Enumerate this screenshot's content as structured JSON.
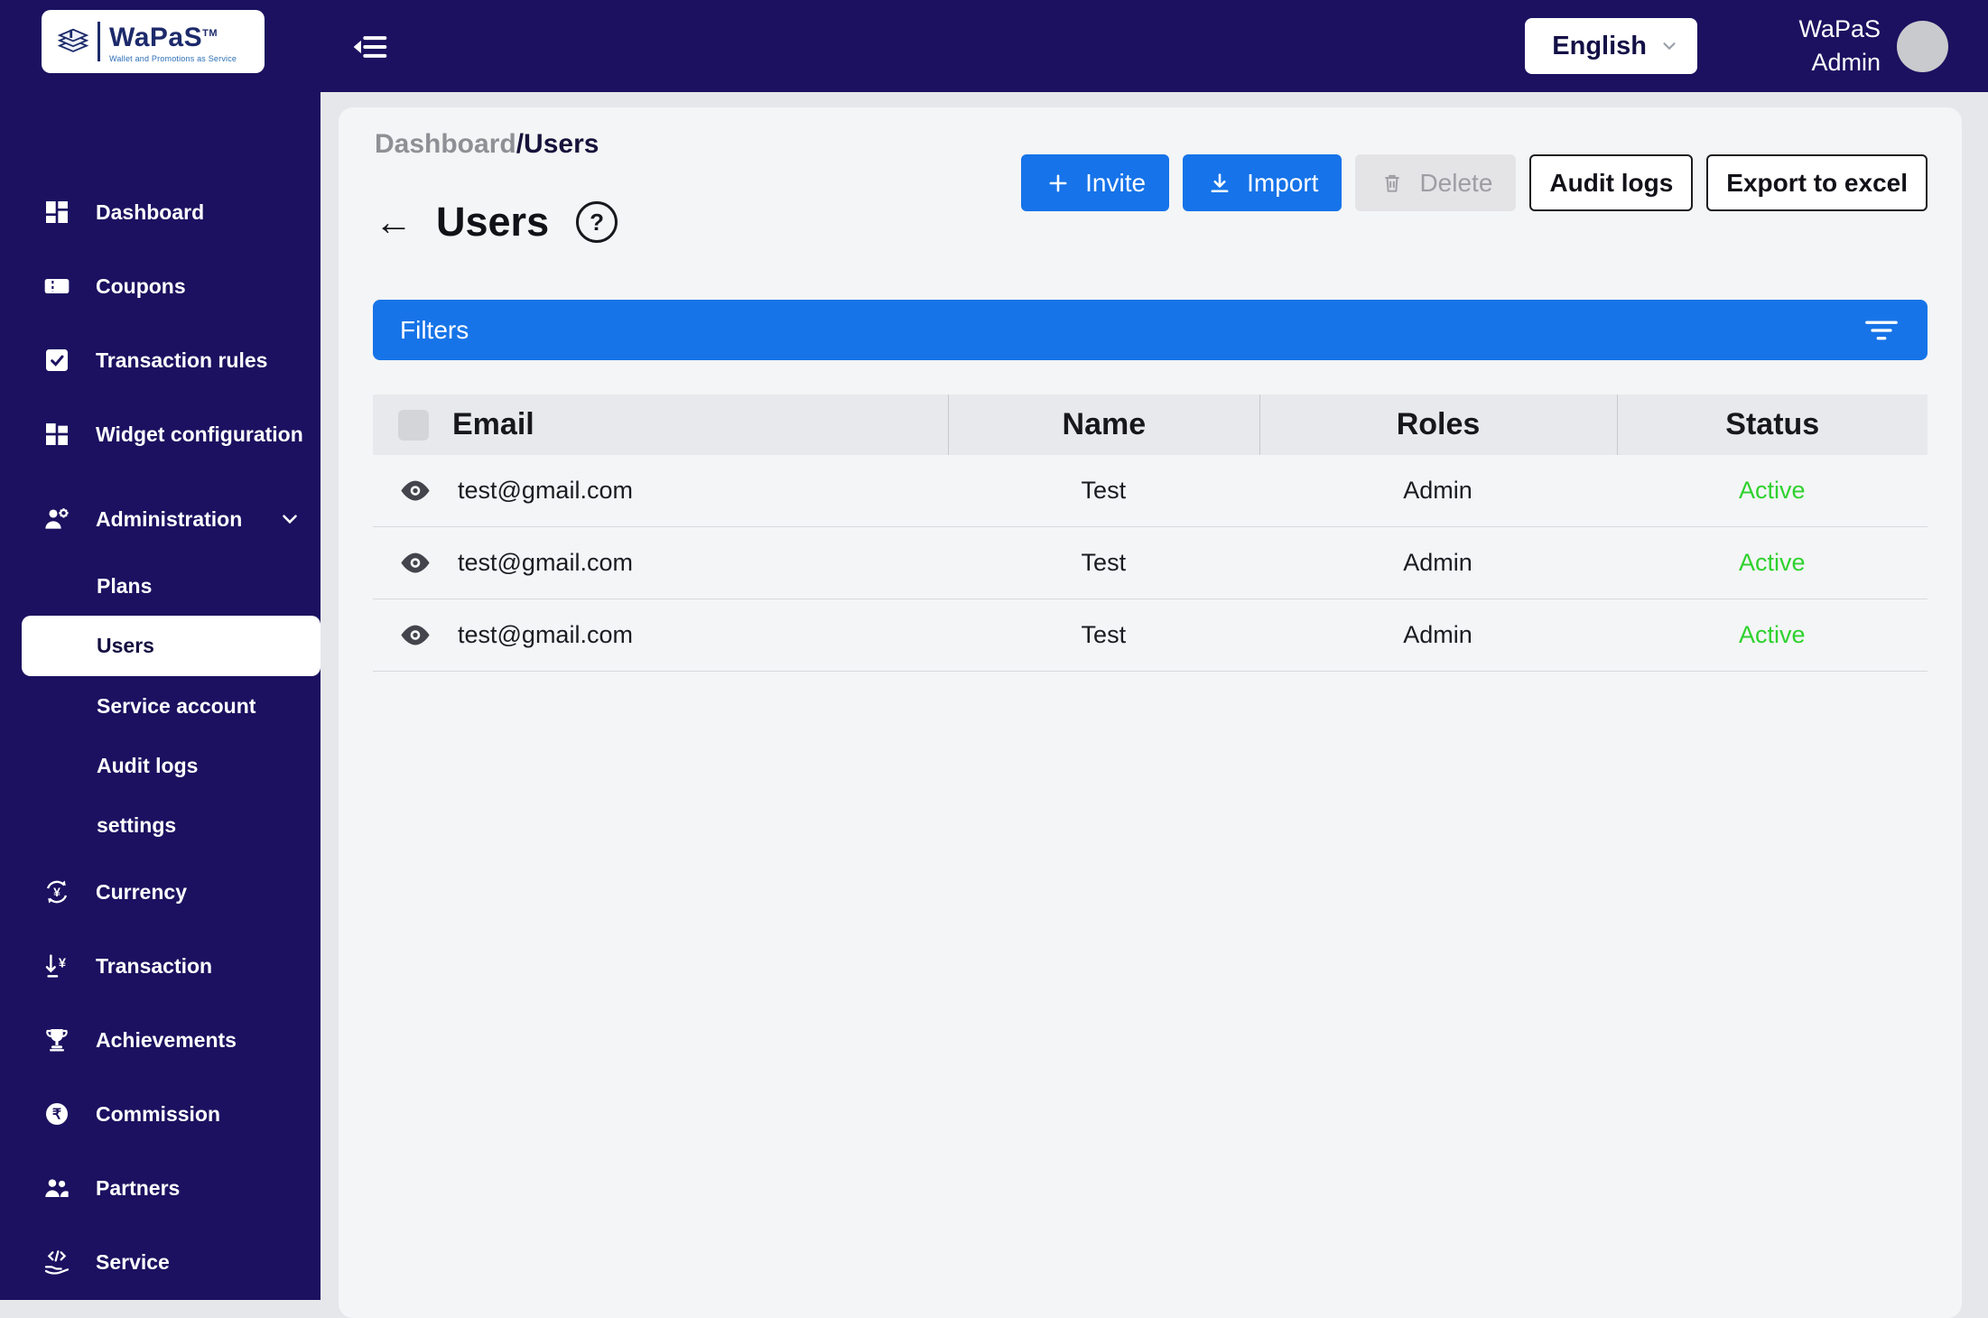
{
  "brand": {
    "name": "WaPaS",
    "tm": "TM",
    "tagline": "Wallet and Promotions as Service"
  },
  "topbar": {
    "language": "English",
    "user_line1": "WaPaS",
    "user_line2": "Admin"
  },
  "sidebar": {
    "items": [
      {
        "label": "Dashboard"
      },
      {
        "label": "Coupons"
      },
      {
        "label": "Transaction rules"
      },
      {
        "label": "Widget configuration"
      },
      {
        "label": "Administration"
      },
      {
        "label": "Currency"
      },
      {
        "label": "Transaction"
      },
      {
        "label": "Achievements"
      },
      {
        "label": "Commission"
      },
      {
        "label": "Partners"
      },
      {
        "label": "Service"
      }
    ],
    "admin_sub": [
      {
        "label": "Plans"
      },
      {
        "label": "Users"
      },
      {
        "label": "Service account"
      },
      {
        "label": "Audit logs"
      },
      {
        "label": "settings"
      }
    ]
  },
  "breadcrumb": {
    "root": "Dashboard",
    "separator": "/",
    "current": "Users"
  },
  "page": {
    "back": "←",
    "title": "Users",
    "help": "?"
  },
  "actions": {
    "invite": "Invite",
    "import": "Import",
    "delete": "Delete",
    "audit_logs": "Audit logs",
    "export": "Export to excel"
  },
  "filters": {
    "label": "Filters"
  },
  "table": {
    "headers": {
      "email": "Email",
      "name": "Name",
      "roles": "Roles",
      "status": "Status"
    },
    "rows": [
      {
        "email": "test@gmail.com",
        "name": "Test",
        "roles": "Admin",
        "status": "Active"
      },
      {
        "email": "test@gmail.com",
        "name": "Test",
        "roles": "Admin",
        "status": "Active"
      },
      {
        "email": "test@gmail.com",
        "name": "Test",
        "roles": "Admin",
        "status": "Active"
      }
    ]
  },
  "colors": {
    "sidebar_navy": "#1b1160",
    "accent_blue": "#1673e9",
    "filters_blue": "#1774e8",
    "active_green": "#2ed22e"
  }
}
